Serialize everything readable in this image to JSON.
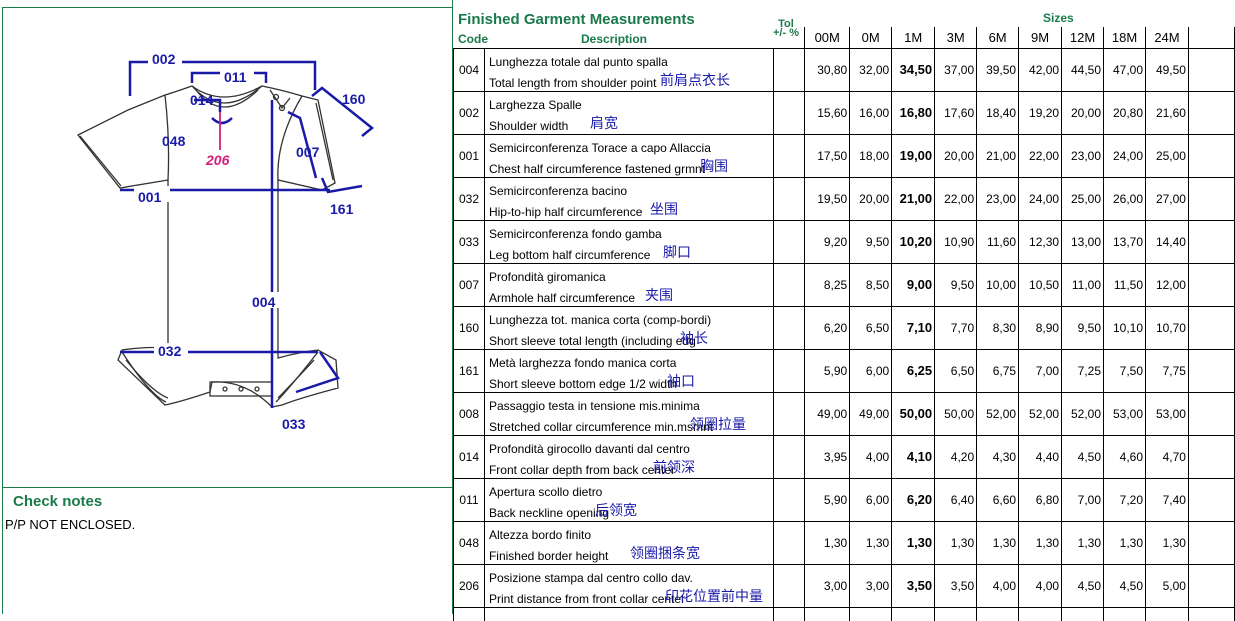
{
  "spec_title": "Finished Garment Measurements",
  "headers": {
    "code": "Code",
    "description": "Description",
    "tol_line1": "Tol",
    "tol_line2": "+/- %",
    "sizes": "Sizes"
  },
  "size_labels": [
    "00M",
    "0M",
    "1M",
    "3M",
    "6M",
    "9M",
    "12M",
    "18M",
    "24M"
  ],
  "rows": [
    {
      "code": "004",
      "it": "Lunghezza totale dal punto spalla",
      "en": "Total length from shoulder point",
      "cn": "前肩点衣长",
      "values": [
        "30,80",
        "32,00",
        "34,50",
        "37,00",
        "39,50",
        "42,00",
        "44,50",
        "47,00",
        "49,50"
      ]
    },
    {
      "code": "002",
      "it": "Larghezza Spalle",
      "en": "Shoulder width",
      "cn": "肩宽",
      "values": [
        "15,60",
        "16,00",
        "16,80",
        "17,60",
        "18,40",
        "19,20",
        "20,00",
        "20,80",
        "21,60"
      ]
    },
    {
      "code": "001",
      "it": "Semicirconferenza Torace a capo Allaccia",
      "en": "Chest half circumference fastened grmnt",
      "cn": "胸围",
      "values": [
        "17,50",
        "18,00",
        "19,00",
        "20,00",
        "21,00",
        "22,00",
        "23,00",
        "24,00",
        "25,00"
      ]
    },
    {
      "code": "032",
      "it": "Semicirconferenza bacino",
      "en": "Hip-to-hip half circumference",
      "cn": "坐围",
      "values": [
        "19,50",
        "20,00",
        "21,00",
        "22,00",
        "23,00",
        "24,00",
        "25,00",
        "26,00",
        "27,00"
      ]
    },
    {
      "code": "033",
      "it": "Semicirconferenza fondo gamba",
      "en": "Leg bottom half circumference",
      "cn": "脚口",
      "values": [
        "9,20",
        "9,50",
        "10,20",
        "10,90",
        "11,60",
        "12,30",
        "13,00",
        "13,70",
        "14,40"
      ]
    },
    {
      "code": "007",
      "it": "Profondità giromanica",
      "en": "Armhole half circumference",
      "cn": "夹围",
      "values": [
        "8,25",
        "8,50",
        "9,00",
        "9,50",
        "10,00",
        "10,50",
        "11,00",
        "11,50",
        "12,00"
      ]
    },
    {
      "code": "160",
      "it": "Lunghezza tot. manica corta (comp-bordi)",
      "en": "Short sleeve total length (including edg",
      "cn": "袖长",
      "values": [
        "6,20",
        "6,50",
        "7,10",
        "7,70",
        "8,30",
        "8,90",
        "9,50",
        "10,10",
        "10,70"
      ]
    },
    {
      "code": "161",
      "it": "Metà larghezza fondo manica corta",
      "en": "Short sleeve bottom edge 1/2 width",
      "cn": "袖口",
      "values": [
        "5,90",
        "6,00",
        "6,25",
        "6,50",
        "6,75",
        "7,00",
        "7,25",
        "7,50",
        "7,75"
      ]
    },
    {
      "code": "008",
      "it": "Passaggio testa in tensione mis.minima",
      "en": "Stretched collar circumference min.msmnt",
      "cn": "领圈拉量",
      "values": [
        "49,00",
        "49,00",
        "50,00",
        "50,00",
        "52,00",
        "52,00",
        "52,00",
        "53,00",
        "53,00"
      ]
    },
    {
      "code": "014",
      "it": "Profondità girocollo davanti dal centro",
      "en": "Front collar depth from back center",
      "cn": "前领深",
      "values": [
        "3,95",
        "4,00",
        "4,10",
        "4,20",
        "4,30",
        "4,40",
        "4,50",
        "4,60",
        "4,70"
      ]
    },
    {
      "code": "011",
      "it": "Apertura scollo dietro",
      "en": "Back neckline opening",
      "cn": "后领宽",
      "values": [
        "5,90",
        "6,00",
        "6,20",
        "6,40",
        "6,60",
        "6,80",
        "7,00",
        "7,20",
        "7,40"
      ]
    },
    {
      "code": "048",
      "it": "Altezza bordo finito",
      "en": "Finished  border  height",
      "cn": "领圈捆条宽",
      "values": [
        "1,30",
        "1,30",
        "1,30",
        "1,30",
        "1,30",
        "1,30",
        "1,30",
        "1,30",
        "1,30"
      ]
    },
    {
      "code": "206",
      "it": "Posizione stampa dal centro collo dav.",
      "en": "Print distance from front collar center",
      "cn": "印花位置前中量",
      "values": [
        "3,00",
        "3,00",
        "3,50",
        "3,50",
        "4,00",
        "4,00",
        "4,50",
        "4,50",
        "5,00"
      ]
    }
  ],
  "sketch_labels": {
    "l002": "002",
    "l011": "011",
    "l014": "014",
    "l160": "160",
    "l048": "048",
    "l206": "206",
    "l007": "007",
    "l001": "001",
    "l161": "161",
    "l004": "004",
    "l032": "032",
    "l033": "033"
  },
  "check_notes": {
    "title": "Check notes",
    "text": "P/P NOT ENCLOSED."
  },
  "colors": {
    "header_green": "#1a7a4a",
    "measure_blue": "#1a1aa8",
    "print_pink": "#d0207a"
  }
}
